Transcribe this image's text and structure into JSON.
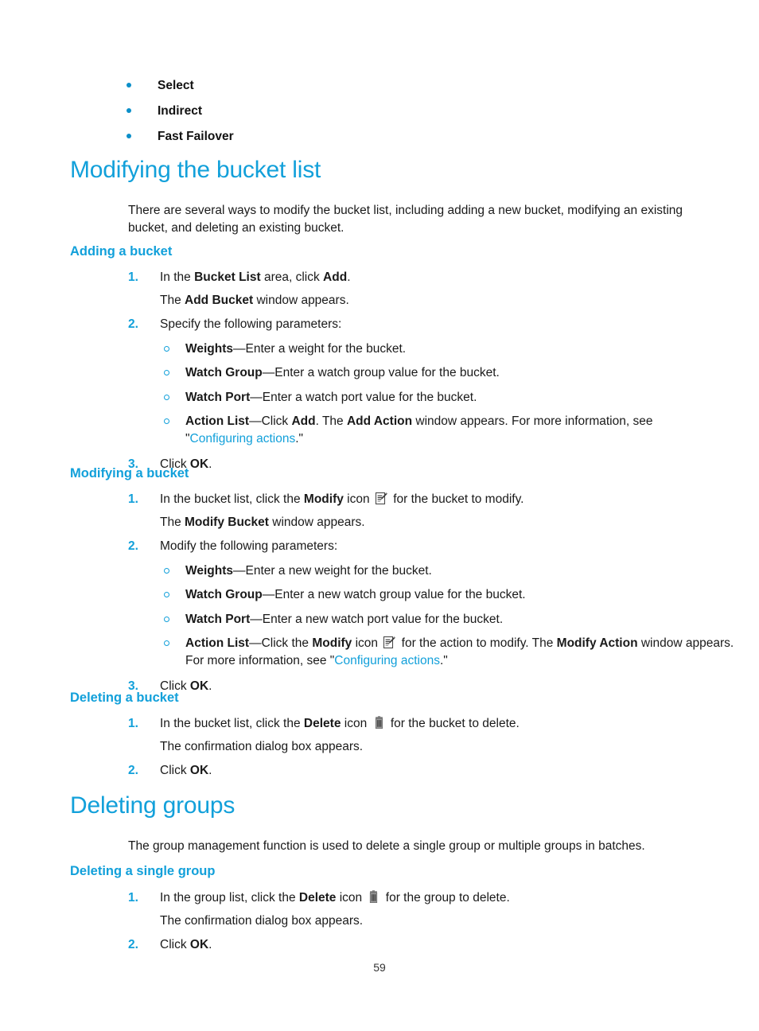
{
  "document": {
    "page_number": "59",
    "accent_color": "#12a0da",
    "bullet_color": "#0b8fc9",
    "text_color": "#1a1a1a"
  },
  "top_bullets": {
    "items": [
      {
        "label": "Select"
      },
      {
        "label": "Indirect"
      },
      {
        "label": "Fast Failover"
      }
    ]
  },
  "section_modifying_bucket_list": {
    "heading": "Modifying the bucket list",
    "intro": "There are several ways to modify the bucket list, including adding a new bucket, modifying an existing bucket, and deleting an existing bucket.",
    "adding": {
      "heading": "Adding a bucket",
      "step1": {
        "num": "1.",
        "text_a": "In the ",
        "bold_a": "Bucket List",
        "text_b": " area, click ",
        "bold_b": "Add",
        "text_c": ".",
        "cont_a": "The ",
        "cont_bold": "Add Bucket",
        "cont_b": " window appears."
      },
      "step2": {
        "num": "2.",
        "text": "Specify the following parameters:",
        "subs": [
          {
            "bold": "Weights",
            "rest": "—Enter a weight for the bucket."
          },
          {
            "bold": "Watch Group",
            "rest": "—Enter a watch group value for the bucket."
          },
          {
            "bold": "Watch Port",
            "rest": "—Enter a watch port value for the bucket."
          },
          {
            "bold": "Action List",
            "rest_a": "—Click ",
            "bold_b": "Add",
            "rest_b": ". The ",
            "bold_c": "Add Action",
            "rest_c": " window appears. For more information, see \"",
            "link": "Configuring actions",
            "rest_d": ".\""
          }
        ]
      },
      "step3": {
        "num": "3.",
        "text_a": "Click ",
        "bold_a": "OK",
        "text_b": "."
      }
    },
    "modifying": {
      "heading": "Modifying a bucket",
      "step1": {
        "num": "1.",
        "text_a": "In the bucket list, click the ",
        "bold_a": "Modify",
        "text_b": " icon ",
        "icon": "modify-icon",
        "text_c": " for the bucket to modify.",
        "cont_a": "The ",
        "cont_bold": "Modify Bucket",
        "cont_b": " window appears."
      },
      "step2": {
        "num": "2.",
        "text": "Modify the following parameters:",
        "subs": [
          {
            "bold": "Weights",
            "rest": "—Enter a new weight for the bucket."
          },
          {
            "bold": "Watch Group",
            "rest": "—Enter a new watch group value for the bucket."
          },
          {
            "bold": "Watch Port",
            "rest": "—Enter a new watch port value for the bucket."
          },
          {
            "bold": "Action List",
            "rest_a": "—Click the ",
            "bold_b": "Modify",
            "rest_b": " icon ",
            "icon": "modify-icon",
            "rest_c": " for the action to modify. The ",
            "bold_c": "Modify Action",
            "rest_d": " window appears. For more information, see \"",
            "link": "Configuring actions",
            "rest_e": ".\""
          }
        ]
      },
      "step3": {
        "num": "3.",
        "text_a": "Click ",
        "bold_a": "OK",
        "text_b": "."
      }
    },
    "deleting": {
      "heading": "Deleting a bucket",
      "step1": {
        "num": "1.",
        "text_a": "In the bucket list, click the ",
        "bold_a": "Delete",
        "text_b": " icon ",
        "icon": "delete-icon",
        "text_c": " for the bucket to delete.",
        "cont": "The confirmation dialog box appears."
      },
      "step2": {
        "num": "2.",
        "text_a": "Click ",
        "bold_a": "OK",
        "text_b": "."
      }
    }
  },
  "section_deleting_groups": {
    "heading": "Deleting groups",
    "intro": "The group management function is used to delete a single group or multiple groups in batches.",
    "single": {
      "heading": "Deleting a single group",
      "step1": {
        "num": "1.",
        "text_a": "In the group list, click the ",
        "bold_a": "Delete",
        "text_b": " icon ",
        "icon": "delete-icon",
        "text_c": " for the group to delete.",
        "cont": "The confirmation dialog box appears."
      },
      "step2": {
        "num": "2.",
        "text_a": "Click ",
        "bold_a": "OK",
        "text_b": "."
      }
    }
  }
}
